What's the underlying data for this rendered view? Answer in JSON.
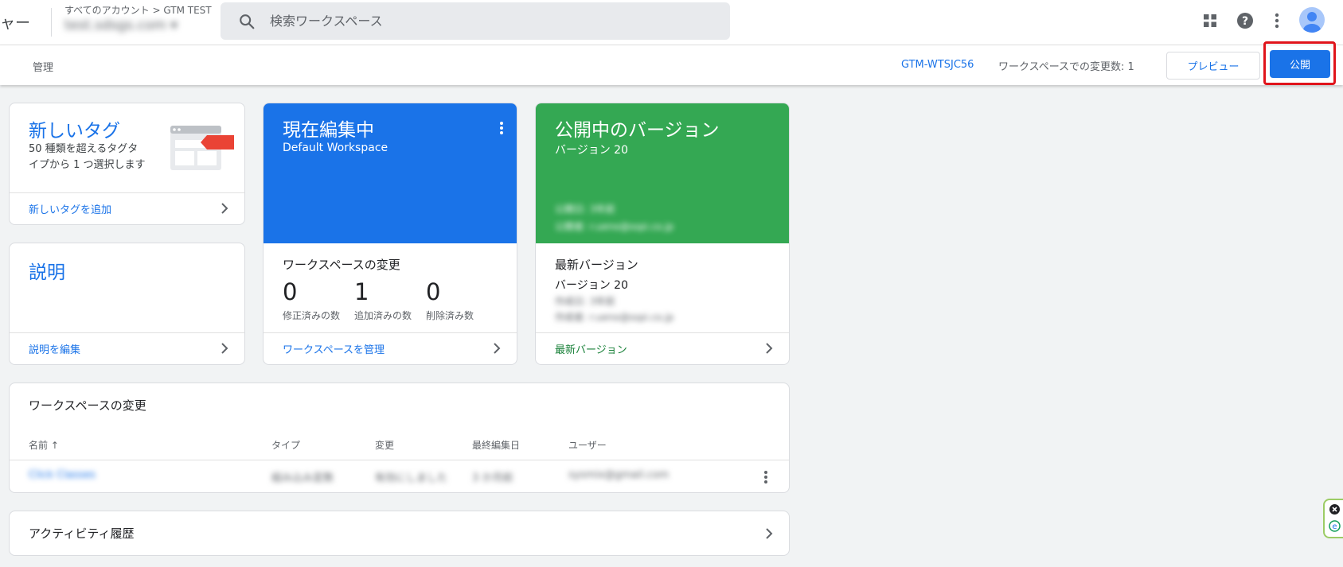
{
  "header": {
    "app_title_fragment": "ャー",
    "breadcrumb": "すべてのアカウント > GTM TEST",
    "container_name": "test.sdsgs.com",
    "search_placeholder": "検索ワークスペース"
  },
  "subbar": {
    "admin_tab": "管理",
    "container_id": "GTM-WTSJC56",
    "workspace_changes": "ワークスペースでの変更数: 1",
    "preview_label": "プレビュー",
    "publish_label": "公開"
  },
  "new_tag_card": {
    "title": "新しいタグ",
    "description": "50 種類を超えるタグタイプから 1 つ選択します",
    "action": "新しいタグを追加"
  },
  "description_card": {
    "title": "説明",
    "action": "説明を編集"
  },
  "current_workspace_card": {
    "title": "現在編集中",
    "workspace_name": "Default Workspace",
    "section_title": "ワークスペースの変更",
    "stats": [
      {
        "value": "0",
        "label": "修正済みの数"
      },
      {
        "value": "1",
        "label": "追加済みの数"
      },
      {
        "value": "0",
        "label": "削除済み数"
      }
    ],
    "action": "ワークスペースを管理"
  },
  "live_version_card": {
    "title": "公開中のバージョン",
    "version": "バージョン 20",
    "published_date": "公開日: 3年前",
    "published_by": "公開者: r.ueno@sspi.co.jp",
    "latest_title": "最新バージョン",
    "latest_version": "バージョン 20",
    "latest_created": "作成日: 3年前",
    "latest_creator": "作成者: r.ueno@sspi.co.jp",
    "action": "最新バージョン"
  },
  "workspace_changes_table": {
    "title": "ワークスペースの変更",
    "columns": [
      "名前 ↑",
      "タイプ",
      "変更",
      "最終編集日",
      "ユーザー"
    ],
    "rows": [
      {
        "name": "Click Classes",
        "type": "組み込み変数",
        "change": "有効にしました",
        "edited": "3 か月前",
        "user": "sysmix@gmail.com"
      }
    ]
  },
  "activity_card": {
    "title": "アクティビティ履歴"
  },
  "colors": {
    "accent_blue": "#1a73e8",
    "live_green": "#34a853",
    "highlight_red": "#e0141b"
  },
  "icons": [
    "search-icon",
    "apps-grid-icon",
    "help-icon",
    "more-vert-icon",
    "account-avatar-icon",
    "chevron-right-icon",
    "tag-illustration-icon",
    "sort-arrow-up-icon",
    "close-circle-icon",
    "extension-e-icon"
  ]
}
